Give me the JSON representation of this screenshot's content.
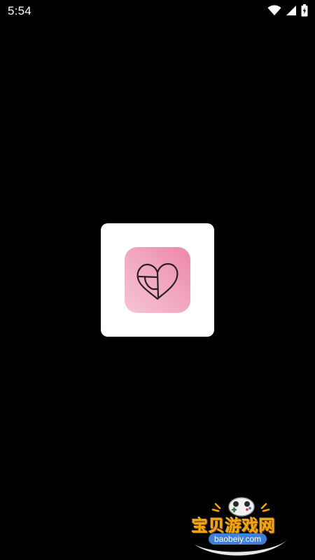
{
  "status_bar": {
    "time": "5:54",
    "icons": [
      "wifi-icon",
      "cell-signal-icon",
      "battery-charging-icon"
    ]
  },
  "splash": {
    "logo_icon": "heart-logo-icon",
    "colors": {
      "card": "#ffffff",
      "icon_gradient_start": "#f6c5d3",
      "icon_gradient_end": "#ec86a6",
      "background": "#000000"
    }
  },
  "watermark": {
    "title": "宝贝游戏网",
    "domain": "baobeiy.com",
    "icon": "gamepad-mascot-icon",
    "colors": {
      "title": "#f5a800",
      "domain_bg": "#3f7fd6"
    }
  }
}
